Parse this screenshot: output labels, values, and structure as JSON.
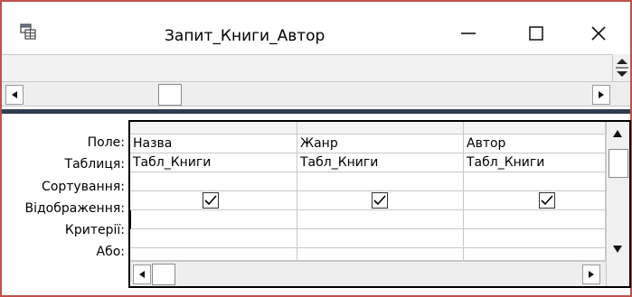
{
  "window": {
    "title": "Запит_Книги_Автор",
    "controls": {
      "minimize_icon": "minimize-icon",
      "maximize_icon": "maximize-icon",
      "close_icon": "close-icon"
    }
  },
  "design_grid": {
    "row_labels": [
      "Поле:",
      "Таблиця:",
      "Сортування:",
      "Відображення:",
      "Критерії:",
      "Або:"
    ],
    "columns": [
      {
        "field": "Назва",
        "table": "Табл_Книги",
        "sort": "",
        "show": true,
        "criteria": "",
        "or": ""
      },
      {
        "field": "Жанр",
        "table": "Табл_Книги",
        "sort": "",
        "show": true,
        "criteria": "",
        "or": ""
      },
      {
        "field": "Автор",
        "table": "Табл_Книги",
        "sort": "",
        "show": true,
        "criteria": "",
        "or": ""
      }
    ]
  },
  "colors": {
    "window_border": "#c0504d",
    "splitter": "#2f3b4e",
    "grid_line": "#c8c8c8"
  }
}
